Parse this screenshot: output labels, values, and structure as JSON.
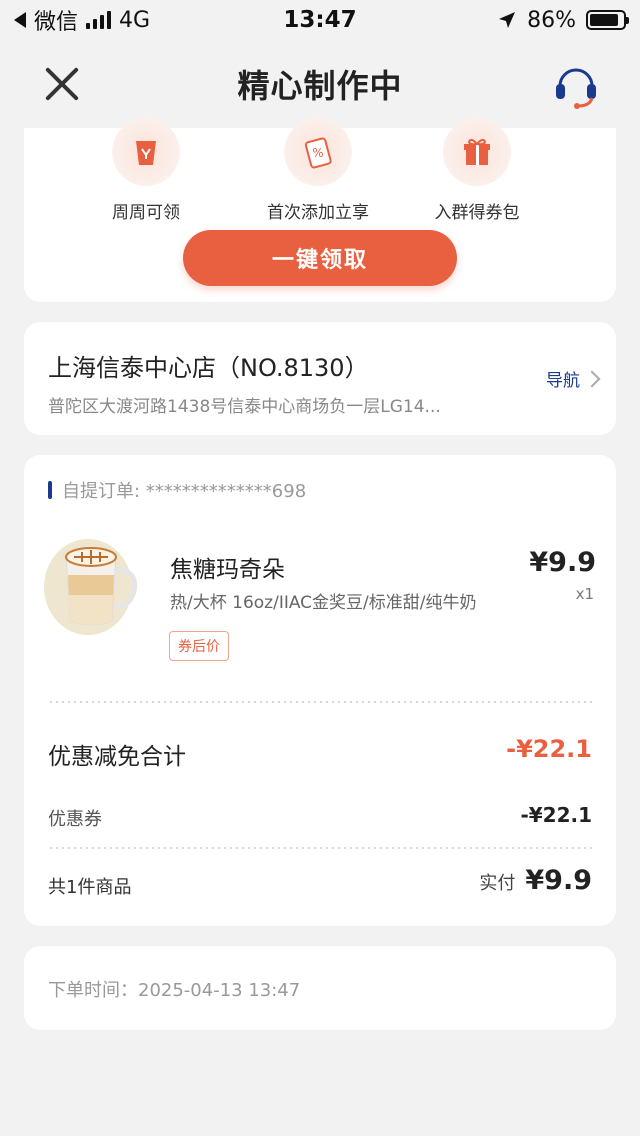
{
  "status_bar": {
    "carrier": "微信",
    "network": "4G",
    "time": "13:47",
    "battery": "86%"
  },
  "nav": {
    "title": "精心制作中"
  },
  "perks": [
    {
      "label": "周周可领",
      "icon": "cup-deer-icon"
    },
    {
      "label": "首次添加立享",
      "icon": "coupon-ticket-icon"
    },
    {
      "label": "入群得券包",
      "icon": "gift-box-icon"
    }
  ],
  "claim_button": "一键领取",
  "store": {
    "name": "上海信泰中心店（NO.8130）",
    "address": "普陀区大渡河路1438号信泰中心商场负一层LG14...",
    "navigate_label": "导航"
  },
  "order": {
    "header": "自提订单: **************698",
    "product": {
      "name": "焦糖玛奇朵",
      "spec": "热/大杯 16oz/IIAC金奖豆/标准甜/纯牛奶",
      "tag": "券后价",
      "price": "¥9.9",
      "qty": "x1"
    },
    "discount_title": "优惠减免合计",
    "discount_total": "-¥22.1",
    "coupon_label": "优惠券",
    "coupon_value": "-¥22.1",
    "count_label": "共1件商品",
    "paid_label": "实付",
    "paid_value": "¥9.9"
  },
  "order_time": "下单时间：2025-04-13 13:47",
  "colors": {
    "accent": "#e8603f",
    "brand_blue": "#1b3a8f",
    "background": "#f2f2f2"
  }
}
